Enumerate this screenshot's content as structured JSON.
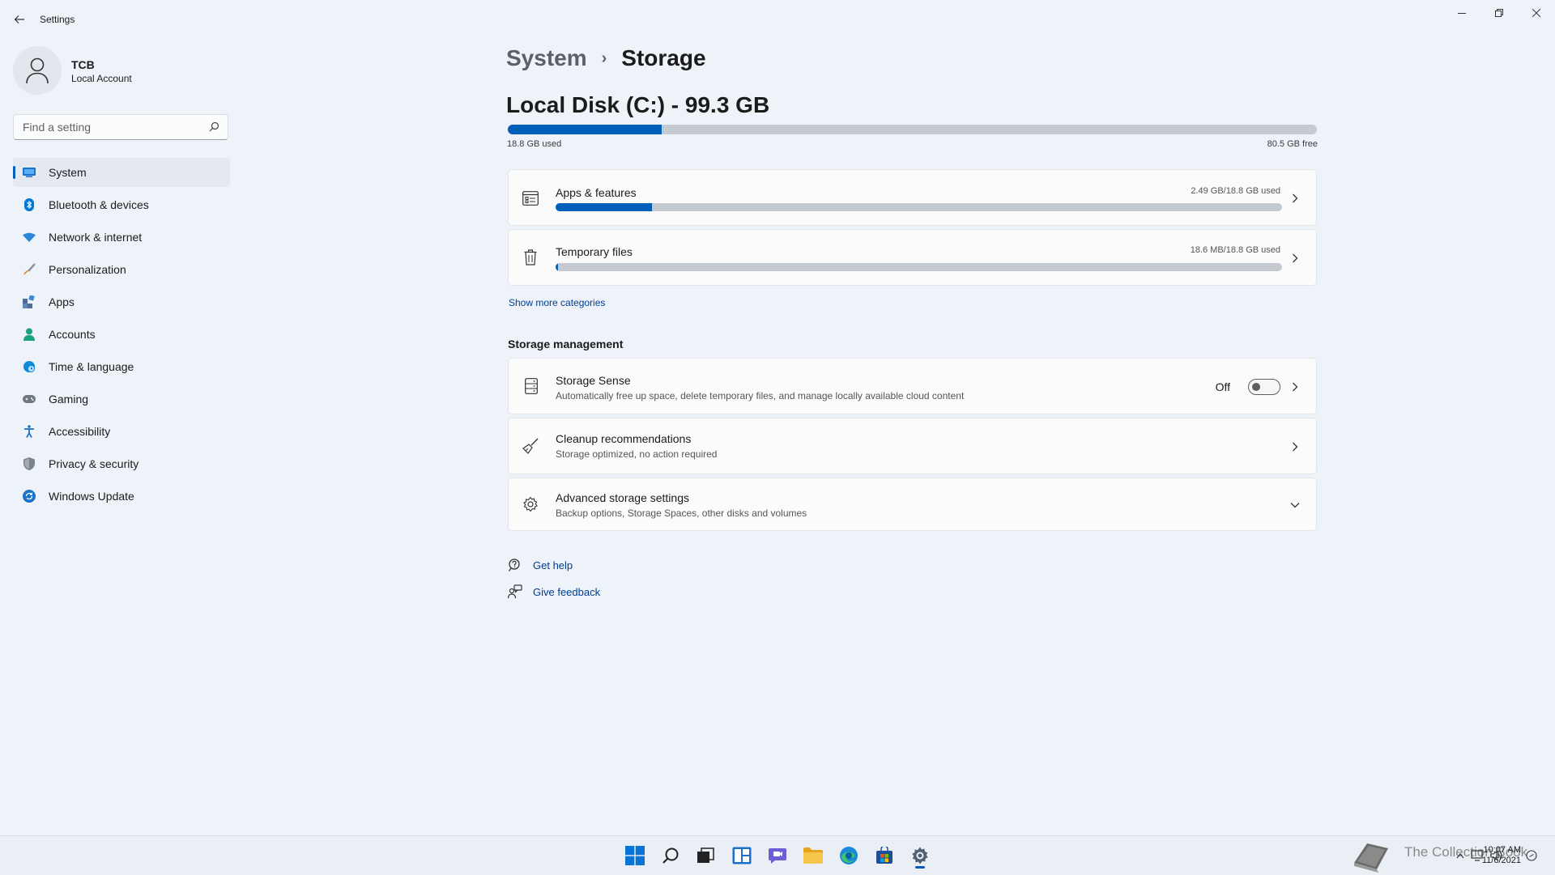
{
  "window": {
    "title": "Settings"
  },
  "account": {
    "name": "TCB",
    "type": "Local Account"
  },
  "search": {
    "placeholder": "Find a setting"
  },
  "nav": {
    "items": [
      {
        "label": "System",
        "icon": "system-icon",
        "color": "#1a73c8"
      },
      {
        "label": "Bluetooth & devices",
        "icon": "bluetooth-icon",
        "color": "#0078d4"
      },
      {
        "label": "Network & internet",
        "icon": "wifi-icon",
        "color": "#2b88d8"
      },
      {
        "label": "Personalization",
        "icon": "brush-icon",
        "color": "#c97a2a"
      },
      {
        "label": "Apps",
        "icon": "apps-icon",
        "color": "#4b6e9c"
      },
      {
        "label": "Accounts",
        "icon": "accounts-icon",
        "color": "#1aa37a"
      },
      {
        "label": "Time & language",
        "icon": "globe-clock-icon",
        "color": "#0e8ad6"
      },
      {
        "label": "Gaming",
        "icon": "gamepad-icon",
        "color": "#6e7680"
      },
      {
        "label": "Accessibility",
        "icon": "accessibility-icon",
        "color": "#1a73c8"
      },
      {
        "label": "Privacy & security",
        "icon": "shield-icon",
        "color": "#6e7680"
      },
      {
        "label": "Windows Update",
        "icon": "update-icon",
        "color": "#1a73c8"
      }
    ],
    "active": "System"
  },
  "breadcrumb": {
    "parent": "System",
    "current": "Storage"
  },
  "disk": {
    "title": "Local Disk (C:) - 99.3 GB",
    "used_label": "18.8 GB used",
    "free_label": "80.5 GB free",
    "used_fraction": 0.19
  },
  "categories": [
    {
      "title": "Apps & features",
      "meta": "2.49 GB/18.8 GB used",
      "fraction": 0.133,
      "icon": "apps-features-icon"
    },
    {
      "title": "Temporary files",
      "meta": "18.6 MB/18.8 GB used",
      "fraction": 0.002,
      "icon": "trash-icon"
    }
  ],
  "show_more": "Show more categories",
  "management": {
    "heading": "Storage management",
    "items": [
      {
        "title": "Storage Sense",
        "sub": "Automatically free up space, delete temporary files, and manage locally available cloud content",
        "toggle_label": "Off",
        "icon": "storage-sense-icon"
      },
      {
        "title": "Cleanup recommendations",
        "sub": "Storage optimized, no action required",
        "icon": "broom-icon"
      },
      {
        "title": "Advanced storage settings",
        "sub": "Backup options, Storage Spaces, other disks and volumes",
        "icon": "gear-icon"
      }
    ]
  },
  "help": {
    "get_help": "Get help",
    "give_feedback": "Give feedback"
  },
  "taskbar": {
    "clock_time": "10:07 AM",
    "clock_date": "11/6/2021",
    "watermark": "The Collection Book",
    "accent": "#005fb8"
  }
}
